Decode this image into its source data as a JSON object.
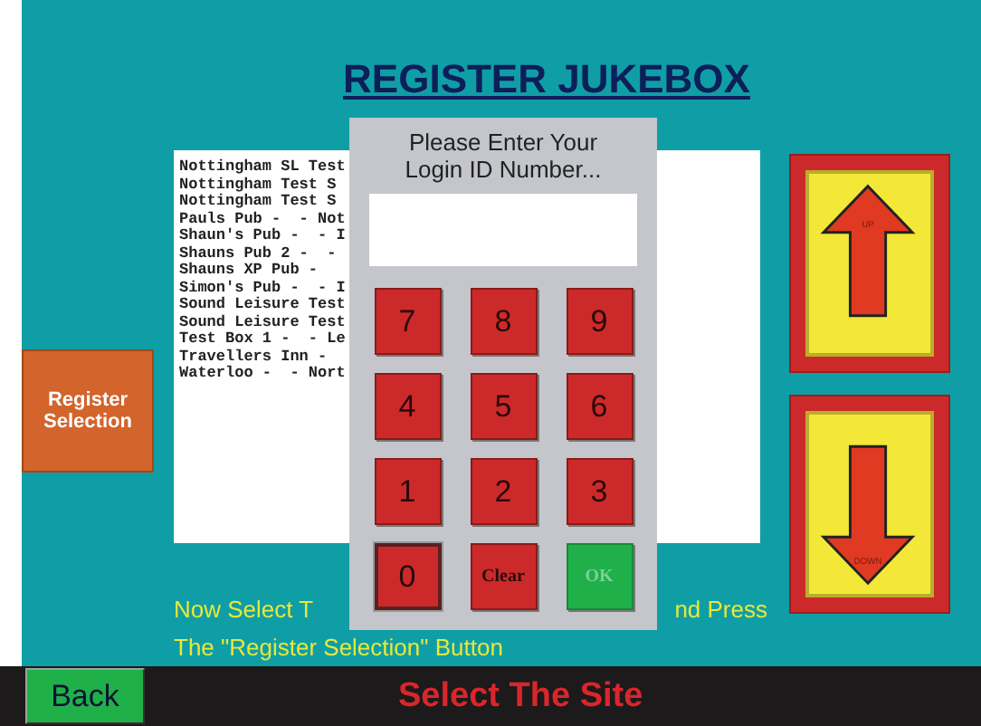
{
  "title": "REGISTER JUKEBOX",
  "register_button": "Register Selection",
  "sites": [
    "Nottingham SL Test",
    "Nottingham Test S",
    "Nottingham Test S",
    "Pauls Pub -  - Not",
    "Shaun's Pub -  - I",
    "Shauns Pub 2 -  -",
    "Shauns XP Pub -",
    "Simon's Pub -  - I",
    "Sound Leisure Test",
    "Sound Leisure Test",
    "Test Box 1 -  - Le",
    "Travellers Inn -",
    "Waterloo -  - Nort"
  ],
  "scroll_buttons": [
    {
      "kind": "up",
      "label": "UP"
    },
    {
      "kind": "down",
      "label": "DOWN"
    }
  ],
  "instructions": {
    "line_1_left": "Now Select T",
    "line_1_right": "nd Press",
    "line_2": "The \"Register Selection\" Button"
  },
  "login_dialog": {
    "prompt": "Please Enter Your Login ID Number...",
    "keys": [
      {
        "label": "7",
        "kind": "digit",
        "focused": false,
        "disabled": false
      },
      {
        "label": "8",
        "kind": "digit",
        "focused": false,
        "disabled": false
      },
      {
        "label": "9",
        "kind": "digit",
        "focused": false,
        "disabled": false
      },
      {
        "label": "4",
        "kind": "digit",
        "focused": false,
        "disabled": false
      },
      {
        "label": "5",
        "kind": "digit",
        "focused": false,
        "disabled": false
      },
      {
        "label": "6",
        "kind": "digit",
        "focused": false,
        "disabled": false
      },
      {
        "label": "1",
        "kind": "digit",
        "focused": false,
        "disabled": false
      },
      {
        "label": "2",
        "kind": "digit",
        "focused": false,
        "disabled": false
      },
      {
        "label": "3",
        "kind": "digit",
        "focused": false,
        "disabled": false
      },
      {
        "label": "0",
        "kind": "digit",
        "focused": true,
        "disabled": false
      },
      {
        "label": "Clear",
        "kind": "clear",
        "focused": false,
        "disabled": false
      },
      {
        "label": "OK",
        "kind": "ok",
        "focused": false,
        "disabled": true
      }
    ]
  },
  "back_button": "Back",
  "status": "Select The Site"
}
